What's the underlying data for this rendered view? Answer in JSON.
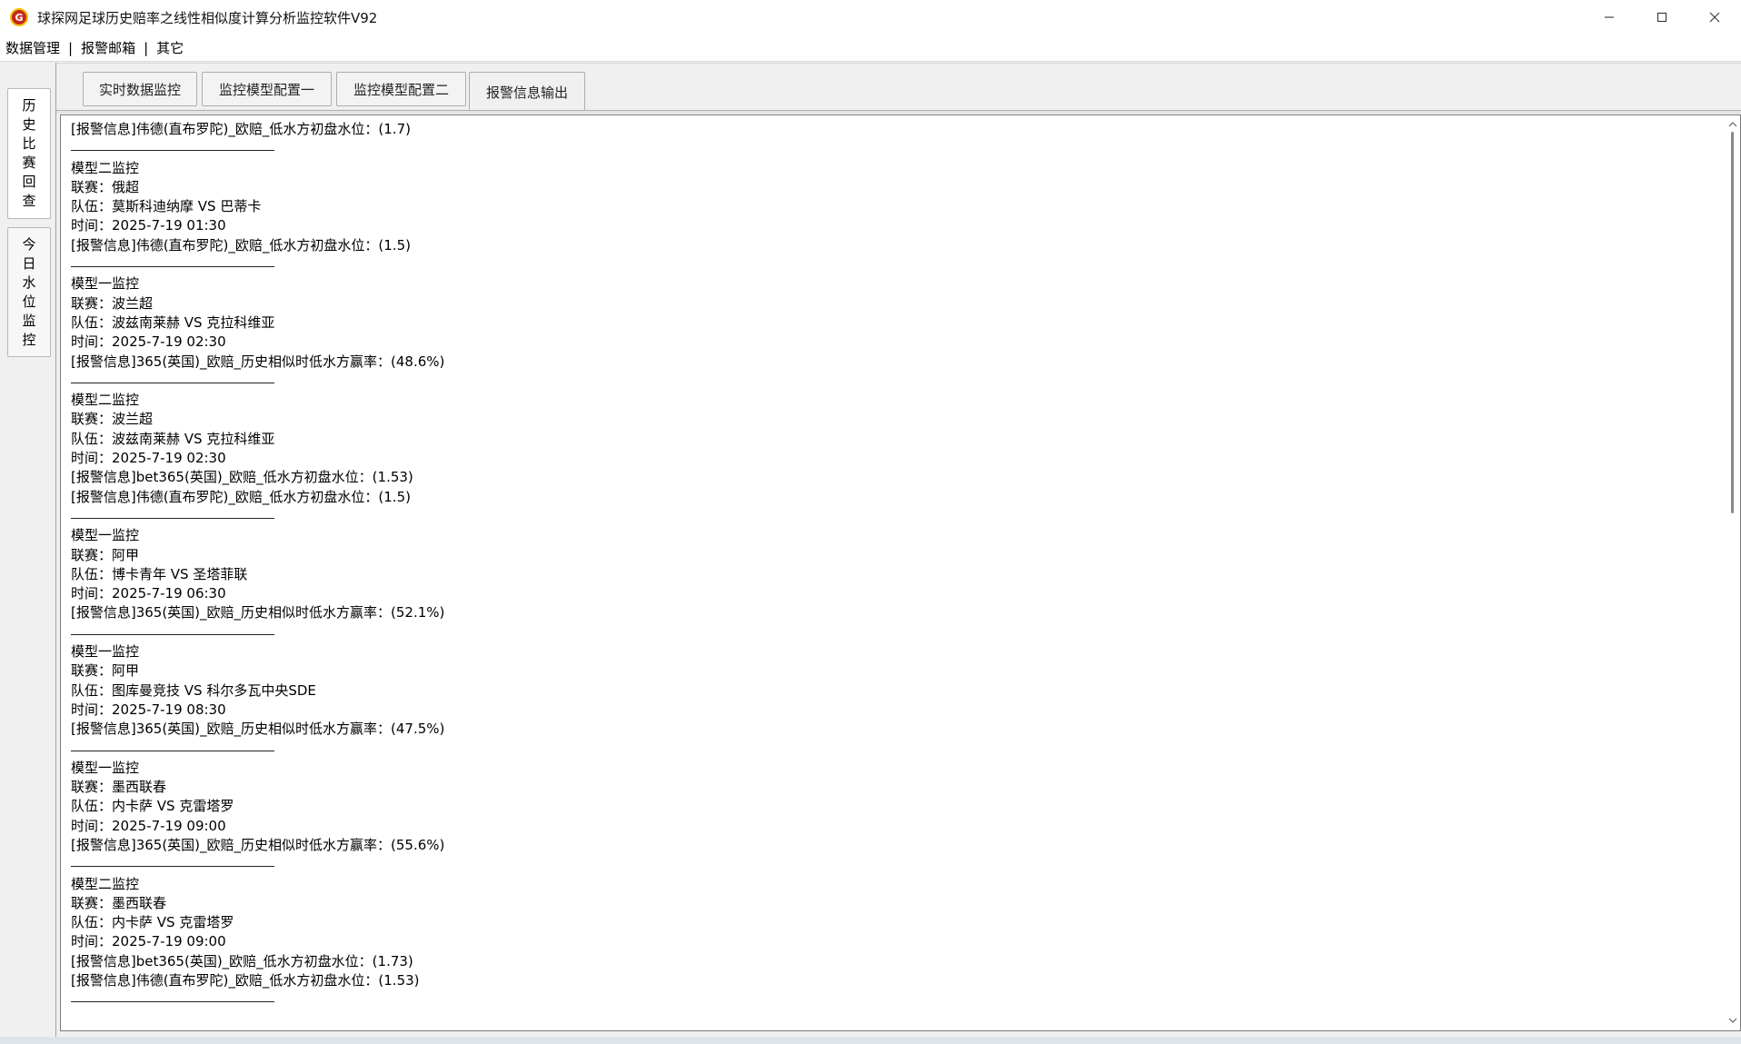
{
  "window": {
    "title": "球探网足球历史赔率之线性相似度计算分析监控软件V92",
    "icon": "app-logo-icon",
    "controls": [
      "minimize-icon",
      "maximize-icon",
      "close-icon"
    ]
  },
  "menu": {
    "items": [
      "数据管理",
      "报警邮箱",
      "其它"
    ],
    "separator": "|"
  },
  "side_tabs": [
    {
      "label": "历史比赛回查",
      "selected": true
    },
    {
      "label": "今日水位监控",
      "selected": false
    }
  ],
  "tabs": [
    {
      "label": "实时数据监控",
      "active": false
    },
    {
      "label": "监控模型配置一",
      "active": false
    },
    {
      "label": "监控模型配置二",
      "active": false
    },
    {
      "label": "报警信息输出",
      "active": true
    }
  ],
  "output": {
    "lines": [
      "[报警信息]伟德(直布罗陀)_欧赔_低水方初盘水位：(1.7)",
      "---",
      "模型二监控",
      "联赛：俄超",
      "队伍：莫斯科迪纳摩 VS 巴蒂卡",
      "时间：2025-7-19 01:30",
      "[报警信息]伟德(直布罗陀)_欧赔_低水方初盘水位：(1.5)",
      "---",
      "模型一监控",
      "联赛：波兰超",
      "队伍：波兹南莱赫 VS 克拉科维亚",
      "时间：2025-7-19 02:30",
      "[报警信息]365(英国)_欧赔_历史相似时低水方赢率：(48.6%)",
      "---",
      "模型二监控",
      "联赛：波兰超",
      "队伍：波兹南莱赫 VS 克拉科维亚",
      "时间：2025-7-19 02:30",
      "[报警信息]bet365(英国)_欧赔_低水方初盘水位：(1.53)",
      "[报警信息]伟德(直布罗陀)_欧赔_低水方初盘水位：(1.5)",
      "---",
      "模型一监控",
      "联赛：阿甲",
      "队伍：博卡青年 VS 圣塔菲联",
      "时间：2025-7-19 06:30",
      "[报警信息]365(英国)_欧赔_历史相似时低水方赢率：(52.1%)",
      "---",
      "模型一监控",
      "联赛：阿甲",
      "队伍：图库曼竞技 VS 科尔多瓦中央SDE",
      "时间：2025-7-19 08:30",
      "[报警信息]365(英国)_欧赔_历史相似时低水方赢率：(47.5%)",
      "---",
      "模型一监控",
      "联赛：墨西联春",
      "队伍：内卡萨 VS 克雷塔罗",
      "时间：2025-7-19 09:00",
      "[报警信息]365(英国)_欧赔_历史相似时低水方赢率：(55.6%)",
      "---",
      "模型二监控",
      "联赛：墨西联春",
      "队伍：内卡萨 VS 克雷塔罗",
      "时间：2025-7-19 09:00",
      "[报警信息]bet365(英国)_欧赔_低水方初盘水位：(1.73)",
      "[报警信息]伟德(直布罗陀)_欧赔_低水方初盘水位：(1.53)",
      "---"
    ]
  }
}
